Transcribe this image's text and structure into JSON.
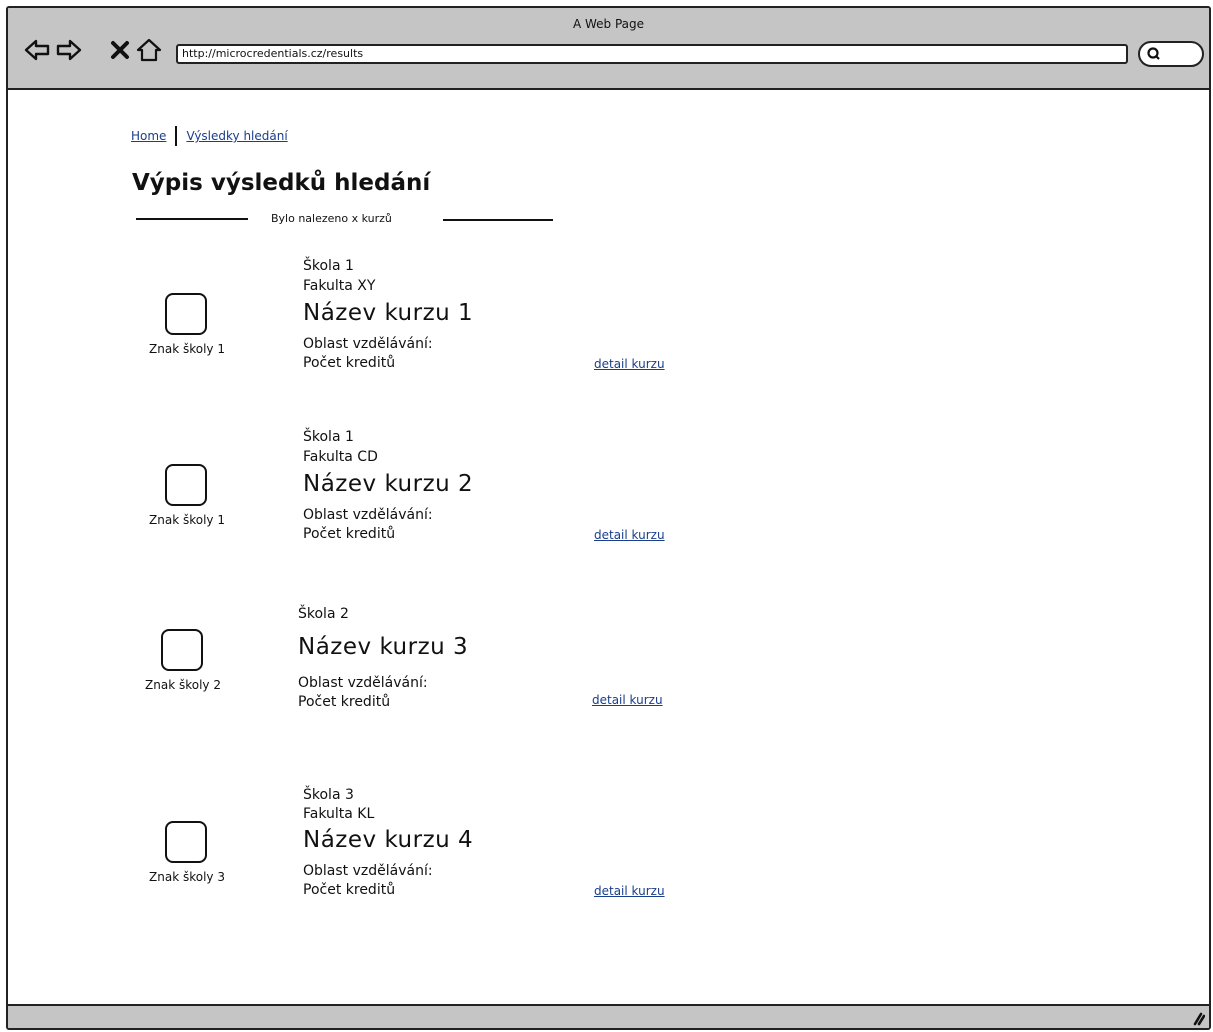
{
  "window": {
    "title": "A Web Page"
  },
  "browser": {
    "url": "http://microcredentials.cz/results"
  },
  "breadcrumb": {
    "home": "Home",
    "current": "Výsledky hledání"
  },
  "page": {
    "title": "Výpis výsledků hledání",
    "result_count": "Bylo nalezeno x kurzů"
  },
  "results": [
    {
      "logo_caption": "Znak školy 1",
      "school": "Škola 1",
      "faculty": "Fakulta XY",
      "course": "Název kurzu 1",
      "area": "Oblast vzdělávání:",
      "credits": "Počet kreditů",
      "detail": "detail kurzu"
    },
    {
      "logo_caption": "Znak školy 1",
      "school": "Škola 1",
      "faculty": "Fakulta CD",
      "course": "Název kurzu 2",
      "area": "Oblast vzdělávání:",
      "credits": "Počet kreditů",
      "detail": "detail kurzu"
    },
    {
      "logo_caption": "Znak školy 2",
      "school": "Škola 2",
      "faculty": "",
      "course": "Název kurzu 3",
      "area": "Oblast vzdělávání:",
      "credits": "Počet kreditů",
      "detail": "detail kurzu"
    },
    {
      "logo_caption": "Znak školy 3",
      "school": "Škola 3",
      "faculty": "Fakulta KL",
      "course": "Název kurzu 4",
      "area": "Oblast vzdělávání:",
      "credits": "Počet kreditů",
      "detail": "detail kurzu"
    }
  ],
  "icons": [
    "back-icon",
    "forward-icon",
    "stop-icon",
    "home-icon",
    "search-icon",
    "resize-grip-icon"
  ]
}
